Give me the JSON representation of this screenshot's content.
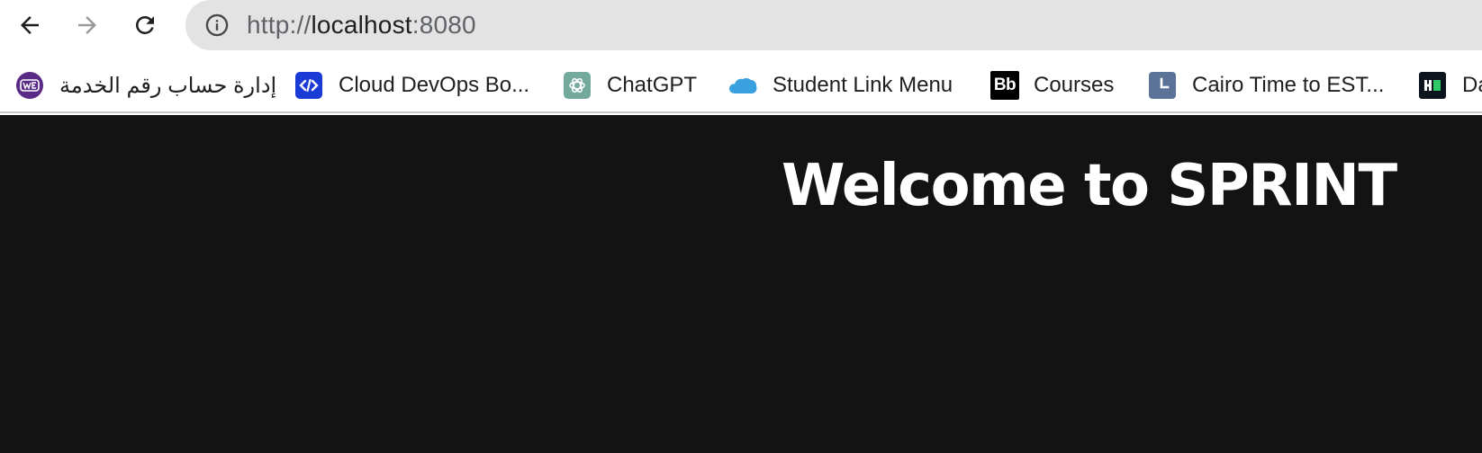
{
  "browser": {
    "url": {
      "scheme": "http://",
      "host": "localhost",
      "port": ":8080"
    },
    "icons": {
      "back": "back-arrow-icon",
      "forward": "forward-arrow-icon",
      "reload": "reload-icon",
      "site_info": "info-icon"
    },
    "forward_enabled": false
  },
  "bookmarks": [
    {
      "label": "إدارة حساب رقم الخدمة",
      "icon": "we-logo-icon",
      "color": "#5a2b86"
    },
    {
      "label": "Cloud DevOps Bo...",
      "icon": "code-logo-icon",
      "color": "#1a3bd6"
    },
    {
      "label": "ChatGPT",
      "icon": "openai-logo-icon",
      "color": "#74aa9c"
    },
    {
      "label": "Student Link Menu",
      "icon": "cloud-logo-icon",
      "color": "#3aa0e0"
    },
    {
      "label": "Courses",
      "icon": "bb-logo-icon",
      "color": "#000000"
    },
    {
      "label": "Cairo Time to EST...",
      "icon": "clock-icon",
      "color": "#5b7396"
    },
    {
      "label": "Da",
      "icon": "hackerrank-logo-icon",
      "color": "#0e141e"
    }
  ],
  "page": {
    "title": "Welcome to SPRINT",
    "background": "#131313",
    "text_color": "#ffffff"
  }
}
